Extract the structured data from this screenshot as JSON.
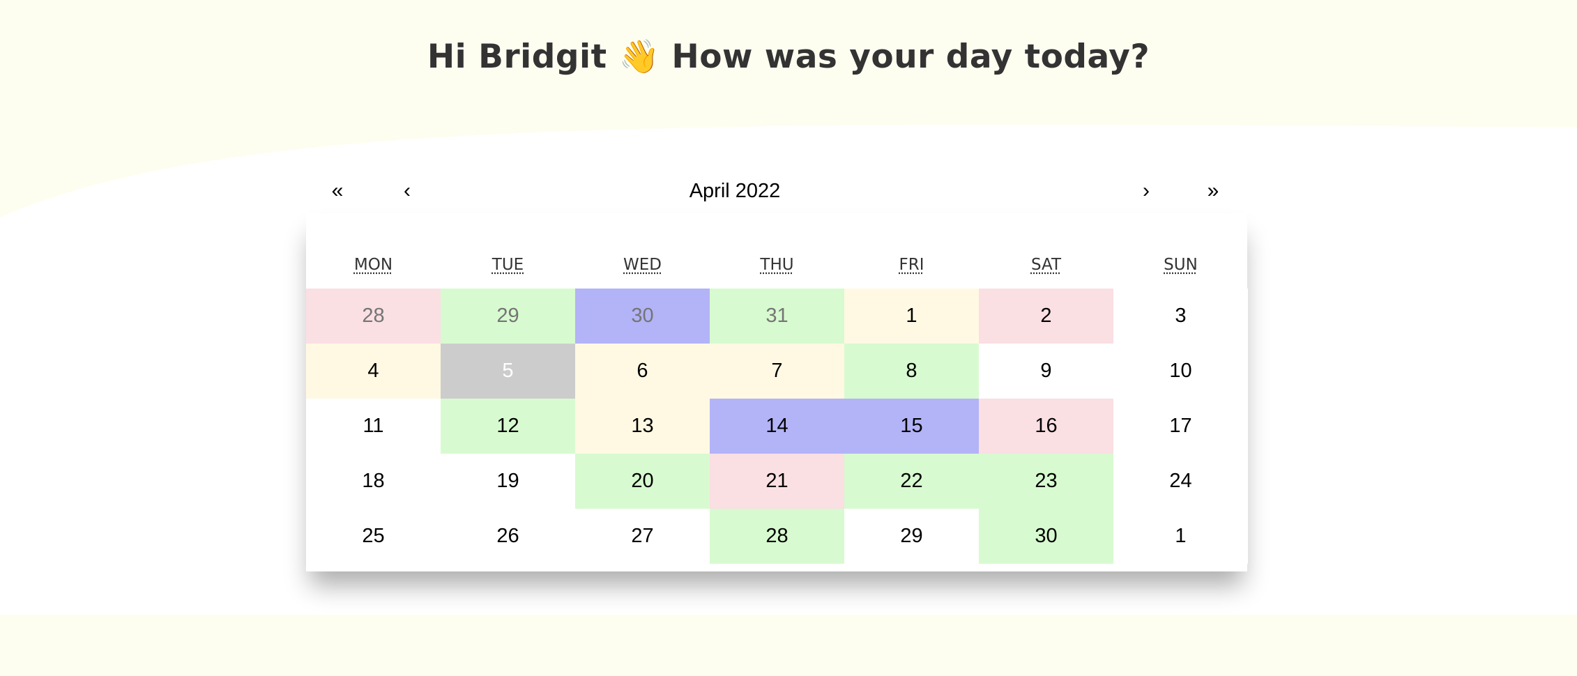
{
  "header": {
    "greeting": "Hi Bridgit",
    "wave_emoji": "👋",
    "question": "How was your day today?"
  },
  "colors": {
    "page_background": "#fefef0",
    "card_background": "#ffffff",
    "title_text": "#333333",
    "mood_pink": "#fadfe3",
    "mood_green": "#d8fad0",
    "mood_purple": "#b3b3f7",
    "mood_cream": "#fff9e3",
    "mood_none": "#ffffff",
    "today_gray": "#cccccc"
  },
  "calendar": {
    "navigation": {
      "prev_year_label": "«",
      "prev_month_label": "‹",
      "month_label": "April 2022",
      "next_month_label": "›",
      "next_year_label": "»"
    },
    "weekdays": [
      "MON",
      "TUE",
      "WED",
      "THU",
      "FRI",
      "SAT",
      "SUN"
    ],
    "days": [
      {
        "label": "28",
        "mood": "pink",
        "neighbor": true
      },
      {
        "label": "29",
        "mood": "green",
        "neighbor": true
      },
      {
        "label": "30",
        "mood": "purple",
        "neighbor": true
      },
      {
        "label": "31",
        "mood": "green",
        "neighbor": true
      },
      {
        "label": "1",
        "mood": "cream"
      },
      {
        "label": "2",
        "mood": "pink"
      },
      {
        "label": "3",
        "mood": "none"
      },
      {
        "label": "4",
        "mood": "cream"
      },
      {
        "label": "5",
        "mood": "today"
      },
      {
        "label": "6",
        "mood": "cream"
      },
      {
        "label": "7",
        "mood": "cream"
      },
      {
        "label": "8",
        "mood": "green"
      },
      {
        "label": "9",
        "mood": "none"
      },
      {
        "label": "10",
        "mood": "none"
      },
      {
        "label": "11",
        "mood": "none"
      },
      {
        "label": "12",
        "mood": "green"
      },
      {
        "label": "13",
        "mood": "cream"
      },
      {
        "label": "14",
        "mood": "purple"
      },
      {
        "label": "15",
        "mood": "purple"
      },
      {
        "label": "16",
        "mood": "pink"
      },
      {
        "label": "17",
        "mood": "none"
      },
      {
        "label": "18",
        "mood": "none"
      },
      {
        "label": "19",
        "mood": "none"
      },
      {
        "label": "20",
        "mood": "green"
      },
      {
        "label": "21",
        "mood": "pink"
      },
      {
        "label": "22",
        "mood": "green"
      },
      {
        "label": "23",
        "mood": "green"
      },
      {
        "label": "24",
        "mood": "none"
      },
      {
        "label": "25",
        "mood": "none"
      },
      {
        "label": "26",
        "mood": "none"
      },
      {
        "label": "27",
        "mood": "none"
      },
      {
        "label": "28",
        "mood": "green"
      },
      {
        "label": "29",
        "mood": "none"
      },
      {
        "label": "30",
        "mood": "green"
      },
      {
        "label": "1",
        "mood": "none",
        "neighbor": true
      }
    ]
  }
}
